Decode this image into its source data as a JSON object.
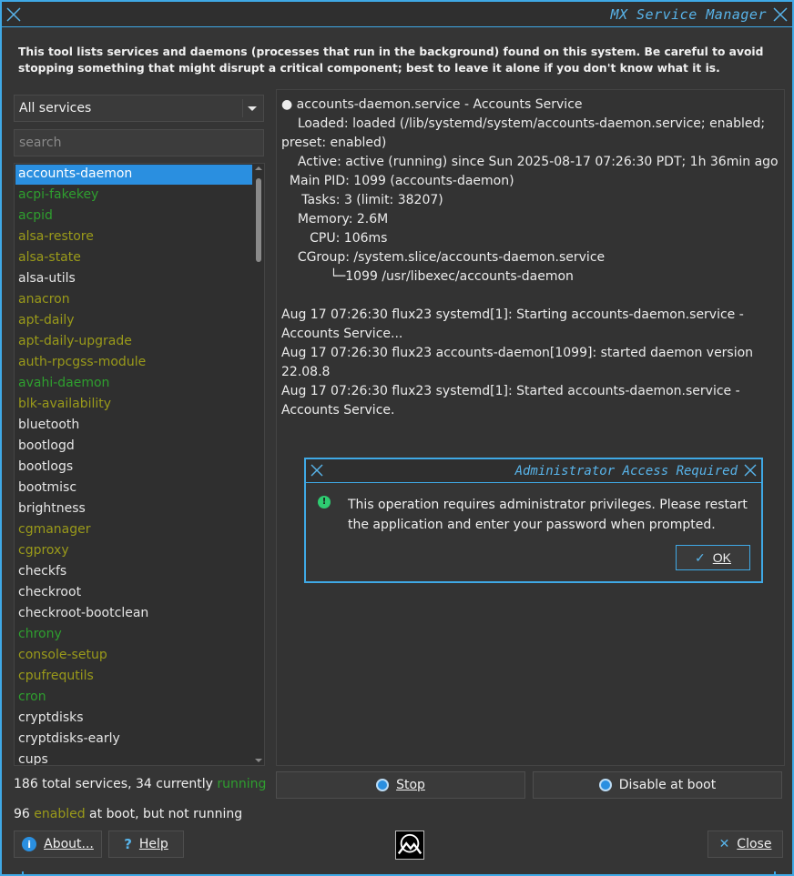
{
  "window": {
    "title": "MX Service Manager"
  },
  "intro": "This tool lists services and daemons (processes that run in the background) found on this system. Be careful to avoid stopping something that might disrupt a critical component; best to leave it alone if you don't know what it is.",
  "filter": {
    "selected": "All services"
  },
  "search": {
    "placeholder": "search"
  },
  "services": [
    {
      "name": "accounts-daemon",
      "state": "sel"
    },
    {
      "name": "acpi-fakekey",
      "state": "running"
    },
    {
      "name": "acpid",
      "state": "running"
    },
    {
      "name": "alsa-restore",
      "state": "enabled"
    },
    {
      "name": "alsa-state",
      "state": "enabled"
    },
    {
      "name": "alsa-utils",
      "state": "normal"
    },
    {
      "name": "anacron",
      "state": "enabled"
    },
    {
      "name": "apt-daily",
      "state": "enabled"
    },
    {
      "name": "apt-daily-upgrade",
      "state": "enabled"
    },
    {
      "name": "auth-rpcgss-module",
      "state": "enabled"
    },
    {
      "name": "avahi-daemon",
      "state": "running"
    },
    {
      "name": "blk-availability",
      "state": "enabled"
    },
    {
      "name": "bluetooth",
      "state": "normal"
    },
    {
      "name": "bootlogd",
      "state": "normal"
    },
    {
      "name": "bootlogs",
      "state": "normal"
    },
    {
      "name": "bootmisc",
      "state": "normal"
    },
    {
      "name": "brightness",
      "state": "normal"
    },
    {
      "name": "cgmanager",
      "state": "enabled"
    },
    {
      "name": "cgproxy",
      "state": "enabled"
    },
    {
      "name": "checkfs",
      "state": "normal"
    },
    {
      "name": "checkroot",
      "state": "normal"
    },
    {
      "name": "checkroot-bootclean",
      "state": "normal"
    },
    {
      "name": "chrony",
      "state": "running"
    },
    {
      "name": "console-setup",
      "state": "enabled"
    },
    {
      "name": "cpufrequtils",
      "state": "enabled"
    },
    {
      "name": "cron",
      "state": "running"
    },
    {
      "name": "cryptdisks",
      "state": "normal"
    },
    {
      "name": "cryptdisks-early",
      "state": "normal"
    },
    {
      "name": "cups",
      "state": "normal"
    }
  ],
  "details": [
    "● accounts-daemon.service - Accounts Service",
    "    Loaded: loaded (/lib/systemd/system/accounts-daemon.service; enabled; preset: enabled)",
    "    Active: active (running) since Sun 2025-08-17 07:26:30 PDT; 1h 36min ago",
    "  Main PID: 1099 (accounts-daemon)",
    "     Tasks: 3 (limit: 38207)",
    "    Memory: 2.6M",
    "       CPU: 106ms",
    "    CGroup: /system.slice/accounts-daemon.service",
    "            └─1099 /usr/libexec/accounts-daemon",
    "",
    "Aug 17 07:26:30 flux23 systemd[1]: Starting accounts-daemon.service - Accounts Service...",
    "Aug 17 07:26:30 flux23 accounts-daemon[1099]: started daemon version 22.08.8",
    "Aug 17 07:26:30 flux23 systemd[1]: Started accounts-daemon.service - Accounts Service."
  ],
  "status": {
    "total_prefix": "186 total services, 34 currently ",
    "running_word": "running",
    "enabled_count": "96 ",
    "enabled_word": "enabled",
    "enabled_suffix": " at boot, but not running"
  },
  "buttons": {
    "stop": "Stop",
    "disable": "Disable at boot",
    "about": "About...",
    "help": "Help",
    "close": "Close"
  },
  "dialog": {
    "title": "Administrator Access Required",
    "message": "This operation requires administrator privileges. Please restart the application and enter your password when prompted.",
    "ok": "OK"
  },
  "colors": {
    "accent": "#3fa9e6",
    "selection": "#2a8fe0",
    "enabled": "#9a9a1a",
    "running": "#2f9f2f"
  }
}
